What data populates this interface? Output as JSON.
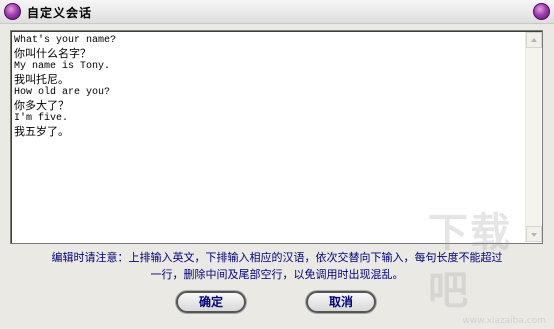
{
  "window": {
    "title": "自定义会话"
  },
  "editor": {
    "lines": [
      {
        "text": "What's your name?",
        "lang": "en"
      },
      {
        "text": "你叫什么名字？",
        "lang": "cn"
      },
      {
        "text": "My name is Tony.",
        "lang": "en"
      },
      {
        "text": "我叫托尼。",
        "lang": "cn"
      },
      {
        "text": "How old are you?",
        "lang": "en"
      },
      {
        "text": "你多大了？",
        "lang": "cn"
      },
      {
        "text": "I'm five.",
        "lang": "en"
      },
      {
        "text": "我五岁了。",
        "lang": "cn"
      }
    ]
  },
  "notice": {
    "line1": "编辑时请注意：上排输入英文，下排输入相应的汉语，依次交替向下输入，每句长度不能超过",
    "line2": "一行，删除中间及尾部空行，以免调用时出现混乱。"
  },
  "buttons": {
    "ok_label": "确定",
    "cancel_label": "取消"
  },
  "watermark": {
    "big": "下载吧",
    "small": "www.xiazaiba.com"
  },
  "colors": {
    "notice_text": "#00007f",
    "button_text": "#00007f",
    "title_icon": "#a040b0"
  }
}
